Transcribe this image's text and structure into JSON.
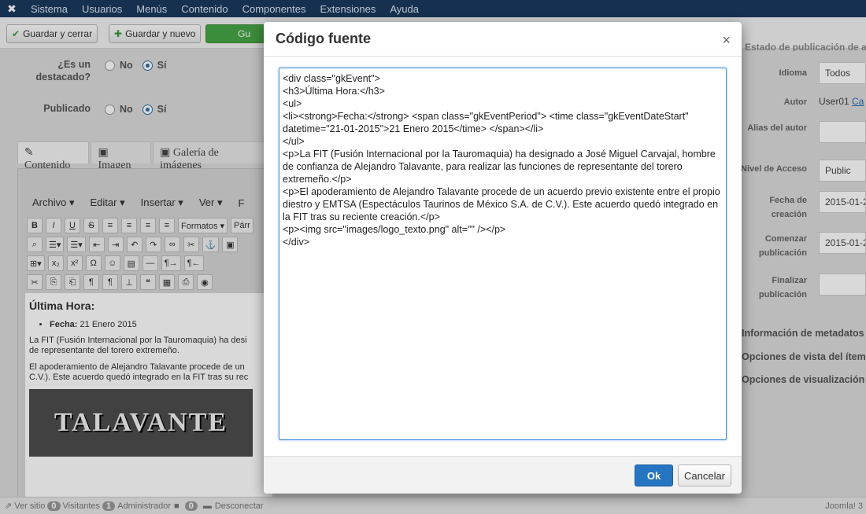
{
  "topbar": {
    "logo_icon": "joomla-icon",
    "menus": [
      "Sistema",
      "Usuarios",
      "Menús",
      "Contenido",
      "Componentes",
      "Extensiones",
      "Ayuda"
    ]
  },
  "toolbar": {
    "save_close": "Guardar y cerrar",
    "save_new": "Guardar y nuevo",
    "save_copy_partial": "Gu"
  },
  "left": {
    "featured_label": "¿Es un destacado?",
    "published_label": "Publicado",
    "no": "No",
    "yes": "Sí",
    "tabs": [
      "Contenido",
      "Imagen",
      "Galería de imágenes"
    ]
  },
  "editor": {
    "menus": [
      "Archivo ▾",
      "Editar ▾",
      "Insertar ▾",
      "Ver ▾",
      "F"
    ],
    "formats": "Formatos ▾",
    "paragraph_partial": "Párr",
    "content": {
      "heading": "Última Hora:",
      "date_label": "Fecha:",
      "date_value": "21 Enero 2015",
      "p1_line1": "La FIT (Fusión Internacional por la Tauromaquia) ha desi",
      "p1_line2": "de representante del torero extremeño.",
      "p2_line1": "El apoderamiento de Alejandro Talavante procede de un",
      "p2_line2": "C.V.). Este acuerdo quedó integrado en la FIT tras su rec",
      "logo_text": "TALAVANTE"
    }
  },
  "right": {
    "header_partial": "Estado de publicación de a",
    "language_label": "Idioma",
    "language_value": "Todos",
    "author_label": "Autor",
    "author_value": "User01",
    "author_link": "Ca",
    "alias_label": "Alias del autor",
    "access_label": "Nivel de Acceso",
    "access_value": "Public",
    "created_label": "Fecha de creación",
    "created_value": "2015-01-2",
    "publish_start_label": "Comenzar publicación",
    "publish_start_value": "2015-01-2",
    "publish_end_label": "Finalizar publicación",
    "panels": [
      "Información de metadatos",
      "Opciones de vista del ítem",
      "Opciones de visualización d"
    ]
  },
  "statusbar": {
    "view_site": "Ver sitio",
    "visitors_count": "0",
    "visitors": "Visitantes",
    "admin_count": "1",
    "admin": "Administrador",
    "messages_count": "0",
    "logout": "Desconectar",
    "version": "Joomla! 3"
  },
  "modal": {
    "title": "Código fuente",
    "close_symbol": "×",
    "code": "<div class=\"gkEvent\">\n<h3>Última Hora:</h3>\n<ul>\n<li><strong>Fecha:</strong> <span class=\"gkEventPeriod\"> <time class=\"gkEventDateStart\" datetime=\"21-01-2015\">21 Enero 2015</time> </span></li>\n</ul>\n<p>La FIT (Fusión Internacional por la Tauromaquia) ha designado a José Miguel Carvajal, hombre de confianza de Alejandro Talavante, para realizar las funciones de representante del torero extremeño.</p>\n<p>El apoderamiento de Alejandro Talavante procede de un acuerdo previo existente entre el propio diestro y EMTSA (Espectáculos Taurinos de México S.A. de C.V.). Este acuerdo quedó integrado en la FIT tras su reciente creación.</p>\n<p><img src=\"images/logo_texto.png\" alt=\"\" /></p>\n</div>",
    "ok": "Ok",
    "cancel": "Cancelar"
  }
}
